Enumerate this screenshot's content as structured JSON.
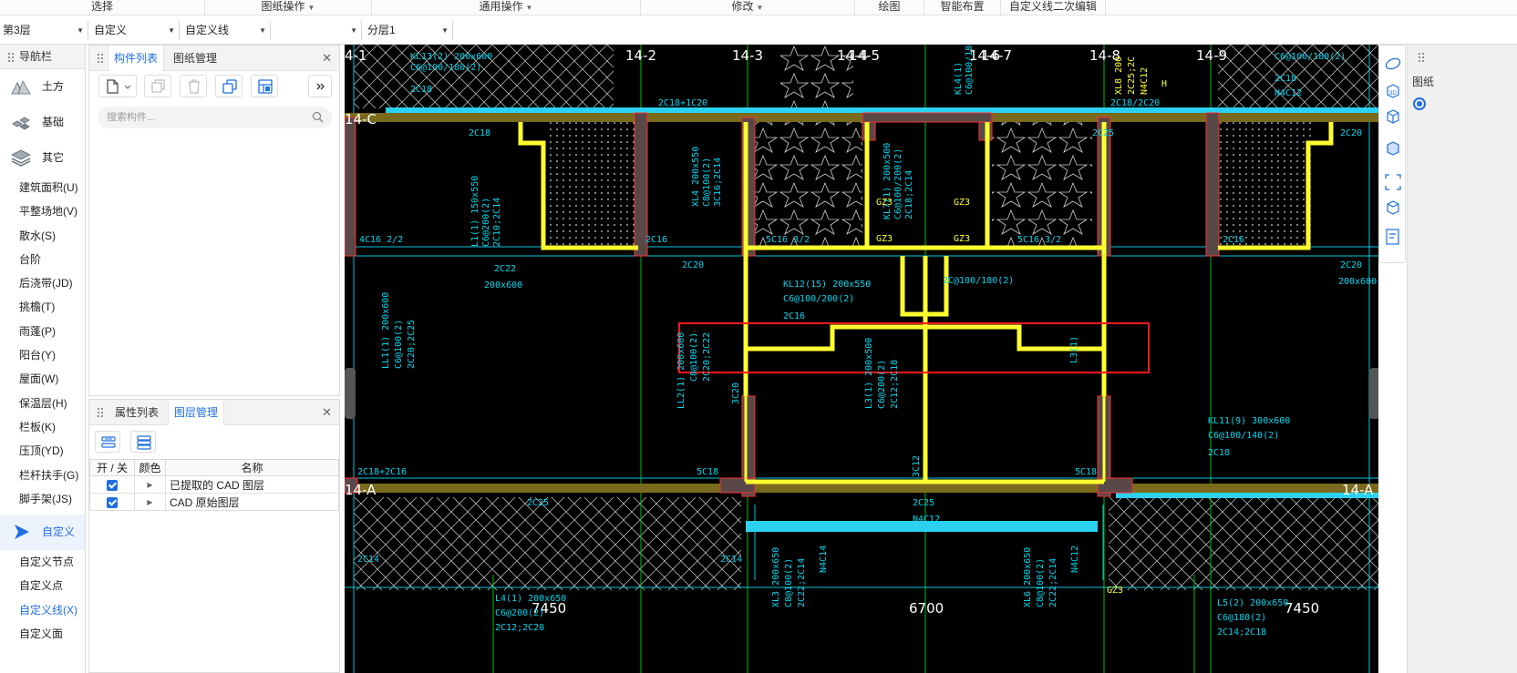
{
  "ribbon": {
    "groups": [
      "选择",
      "图纸操作",
      "通用操作",
      "修改",
      "绘图",
      "智能布置",
      "自定义线二次编辑"
    ]
  },
  "selectors": {
    "floor": "第3层",
    "category": "自定义",
    "type": "自定义线",
    "blank": "",
    "layer": "分层1"
  },
  "nav": {
    "title": "导航栏",
    "categories": [
      {
        "label": "土方",
        "icon": "earthwork-icon"
      },
      {
        "label": "基础",
        "icon": "foundation-icon"
      },
      {
        "label": "其它",
        "icon": "layers-icon"
      }
    ],
    "items": [
      "建筑面积(U)",
      "平整场地(V)",
      "散水(S)",
      "台阶",
      "后浇带(JD)",
      "挑檐(T)",
      "雨蓬(P)",
      "阳台(Y)",
      "屋面(W)",
      "保温层(H)",
      "栏板(K)",
      "压顶(YD)",
      "栏杆扶手(G)",
      "脚手架(JS)"
    ],
    "active_category": {
      "label": "自定义",
      "icon": "play-icon"
    },
    "sub_items": [
      "自定义节点",
      "自定义点",
      "自定义线(X)",
      "自定义面"
    ]
  },
  "component_panel": {
    "tabs": [
      "构件列表",
      "图纸管理"
    ],
    "search_placeholder": "搜索构件..."
  },
  "layer_panel": {
    "tabs": [
      "属性列表",
      "图层管理"
    ],
    "columns": [
      "开 / 关",
      "颜色",
      "名称"
    ],
    "rows": [
      {
        "checked": true,
        "name": "已提取的 CAD 图层"
      },
      {
        "checked": true,
        "name": "CAD 原始图层"
      }
    ]
  },
  "cad": {
    "axis_labels": [
      "4-1",
      "14-2",
      "14-3",
      "14-4",
      "14-5",
      "14-6",
      "14-7",
      "14-8",
      "14-9",
      "14-C",
      "14-A",
      "14-A"
    ],
    "dimensions": [
      "7450",
      "6700",
      "7450"
    ],
    "annotations": [
      "KL13(2) 200x600",
      "C6@100/180(2)",
      "2C18",
      "2C18",
      "2C18+1C20",
      "XL4 200x550",
      "C8@100(2)",
      "3C16;2C14",
      "KL7(1) 200x500",
      "C6@100/200(2)",
      "2C18;2C14",
      "GZ3",
      "GZ3",
      "GZ3",
      "GZ3",
      "L1(1) 150x550",
      "C6@200(2)",
      "2C10;2C14",
      "4C16 2/2",
      "2C16",
      "5C16 3/2",
      "5C16 3/2",
      "2C16",
      "2C25",
      "2C20",
      "2C22",
      "200x600",
      "2C20",
      "KL12(15) 200x550",
      "C6@100/200(2)",
      "2C16",
      "2C@100/180(2)",
      "LL1(1) 200x600",
      "C6@100(2)",
      "2C20;2C25",
      "LL2(1) 200x600",
      "C8@100(2)",
      "2C20;2C22",
      "3C20",
      "L3(1) 200x500",
      "C6@200(2)",
      "2C12;2C18",
      "3C12",
      "L3(1)",
      "KL11(9) 300x600",
      "C6@100/140(2)",
      "2C18",
      "2C18+2C16",
      "5C18",
      "5C18",
      "2C25",
      "N4C12",
      "2C25",
      "2C14",
      "2C14",
      "XL3 200x650",
      "C8@100(2)",
      "2C22;2C14",
      "N4C14",
      "XL6 200x650",
      "C8@100(2)",
      "2C22;2C14",
      "N4C12",
      "L4(1) 200x650",
      "C6@200(2)",
      "2C12;2C20",
      "L5(2) 200x650",
      "C6@180(2)",
      "2C14;2C18",
      "2C18/2C20",
      "XL8 200",
      "2C25;2C",
      "N4C12",
      "H",
      "C6@100/180(2)",
      "2C18",
      "N4C12",
      "2C20",
      "200x600",
      "GZ3",
      "KL4(1)",
      "C6@100/180(2)"
    ]
  },
  "right_panel": {
    "tab_label": "图纸"
  }
}
